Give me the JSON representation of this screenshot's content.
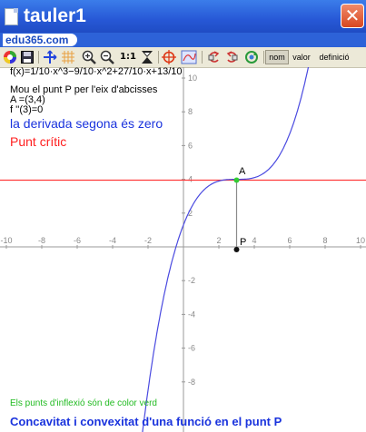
{
  "window": {
    "title": "tauler1",
    "close_glyph": "✕"
  },
  "logo": "edu365.com",
  "toolbar": {
    "zoom_11": "1:1",
    "nom": "nom",
    "valor": "valor",
    "definicio": "definició"
  },
  "graph": {
    "function_text": "f(x)=1/10·x^3−9/10·x^2+27/10·x+13/10",
    "instruction": "Mou el punt P per l'eix d'abcisses",
    "coord_a": "A =(3,4)",
    "second_derivative": "f ''(3)=0",
    "message_blue": "la derivada segona és zero",
    "message_red": "Punt crític",
    "inflection_note": "Els punts d'inflexió són de color verd",
    "footer_title": "Concavitat i convexitat d'una funció en el punt P",
    "point_a_label": "A",
    "point_p_label": "P",
    "x_ticks": [
      "-10",
      "-8",
      "-6",
      "-4",
      "-2",
      "2",
      "4",
      "6",
      "8",
      "10"
    ],
    "y_ticks": [
      "10",
      "8",
      "6",
      "4",
      "2",
      "-2",
      "-4",
      "-6",
      "-8"
    ]
  },
  "colors": {
    "curve": "#4a4ae0",
    "tangent": "#ff3b3b",
    "inflection_point": "#33cc33",
    "blue_text": "#1a33dd",
    "red_text": "#ff2020",
    "green_text": "#22bb22"
  }
}
